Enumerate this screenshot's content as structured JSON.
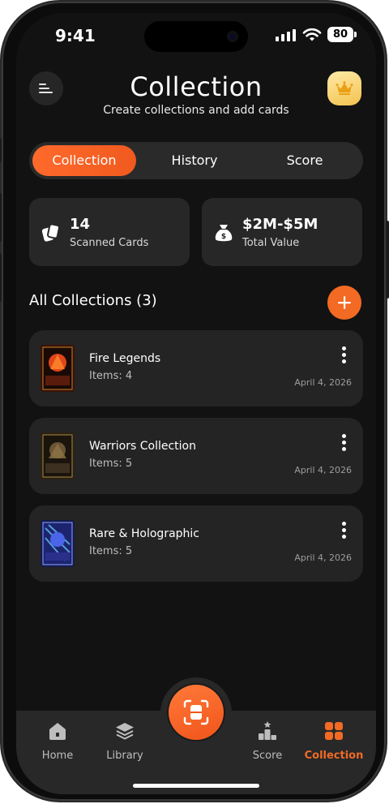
{
  "status": {
    "time": "9:41",
    "battery": "80"
  },
  "header": {
    "title": "Collection",
    "subtitle": "Create collections and add cards"
  },
  "tabs": [
    {
      "label": "Collection",
      "active": true
    },
    {
      "label": "History",
      "active": false
    },
    {
      "label": "Score",
      "active": false
    }
  ],
  "stats": {
    "scanned": {
      "value": "14",
      "label": "Scanned Cards"
    },
    "total": {
      "value": "$2M-$5M",
      "label": "Total Value"
    }
  },
  "collections_header": "All Collections (3)",
  "collections": [
    {
      "name": "Fire Legends",
      "items": "Items: 4",
      "date": "April 4, 2026",
      "thumb_icon": "fire-card-thumbnail"
    },
    {
      "name": "Warriors Collection",
      "items": "Items: 5",
      "date": "April 4, 2026",
      "thumb_icon": "warrior-card-thumbnail"
    },
    {
      "name": "Rare & Holographic",
      "items": "Items: 5",
      "date": "April 4, 2026",
      "thumb_icon": "holo-card-thumbnail"
    }
  ],
  "nav": [
    {
      "label": "Home",
      "icon": "home-icon",
      "active": false
    },
    {
      "label": "Library",
      "icon": "layers-icon",
      "active": false
    },
    {
      "label": "Score",
      "icon": "podium-icon",
      "active": false
    },
    {
      "label": "Collection",
      "icon": "grid-icon",
      "active": true
    }
  ],
  "colors": {
    "accent": "#f26a24",
    "background": "#121212",
    "card": "#242424",
    "gold": "#f3c24f"
  }
}
